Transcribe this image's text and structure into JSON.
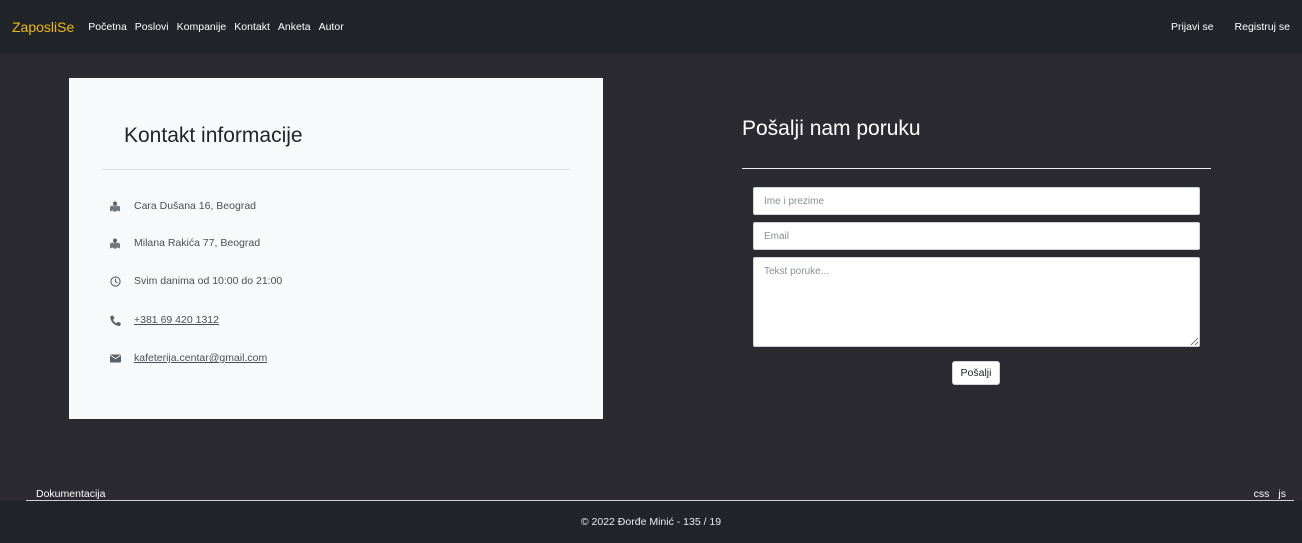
{
  "navbar": {
    "brand": "ZaposliSe",
    "links": [
      "Početna",
      "Poslovi",
      "Kompanije",
      "Kontakt",
      "Anketa",
      "Autor"
    ],
    "login": "Prijavi se",
    "register": "Registruj se"
  },
  "contact_info": {
    "title": "Kontakt informacije",
    "items": [
      {
        "icon": "map-location-icon",
        "text": "Cara Dušana 16, Beograd"
      },
      {
        "icon": "map-location-icon",
        "text": "Milana Rakića 77, Beograd"
      },
      {
        "icon": "clock-icon",
        "text": "Svim danima od 10:00 do 21:00"
      },
      {
        "icon": "phone-icon",
        "text": "+381 69 420 1312"
      },
      {
        "icon": "envelope-icon",
        "text": "kafeterija.centar@gmail.com"
      }
    ]
  },
  "message_form": {
    "title": "Pošalji nam poruku",
    "name_placeholder": "Ime i prezime",
    "email_placeholder": "Email",
    "message_placeholder": "Tekst poruke...",
    "submit_label": "Pošalji"
  },
  "footer": {
    "documentation": "Dokumentacija",
    "css_link": "css",
    "js_link": "js",
    "copyright": "© 2022 Đorđe Minić - 135 / 19"
  },
  "colors": {
    "brand": "#f0b90b",
    "navbar_bg": "#212529",
    "page_bg": "#2b2a30",
    "card_bg": "#f8f9fa"
  }
}
